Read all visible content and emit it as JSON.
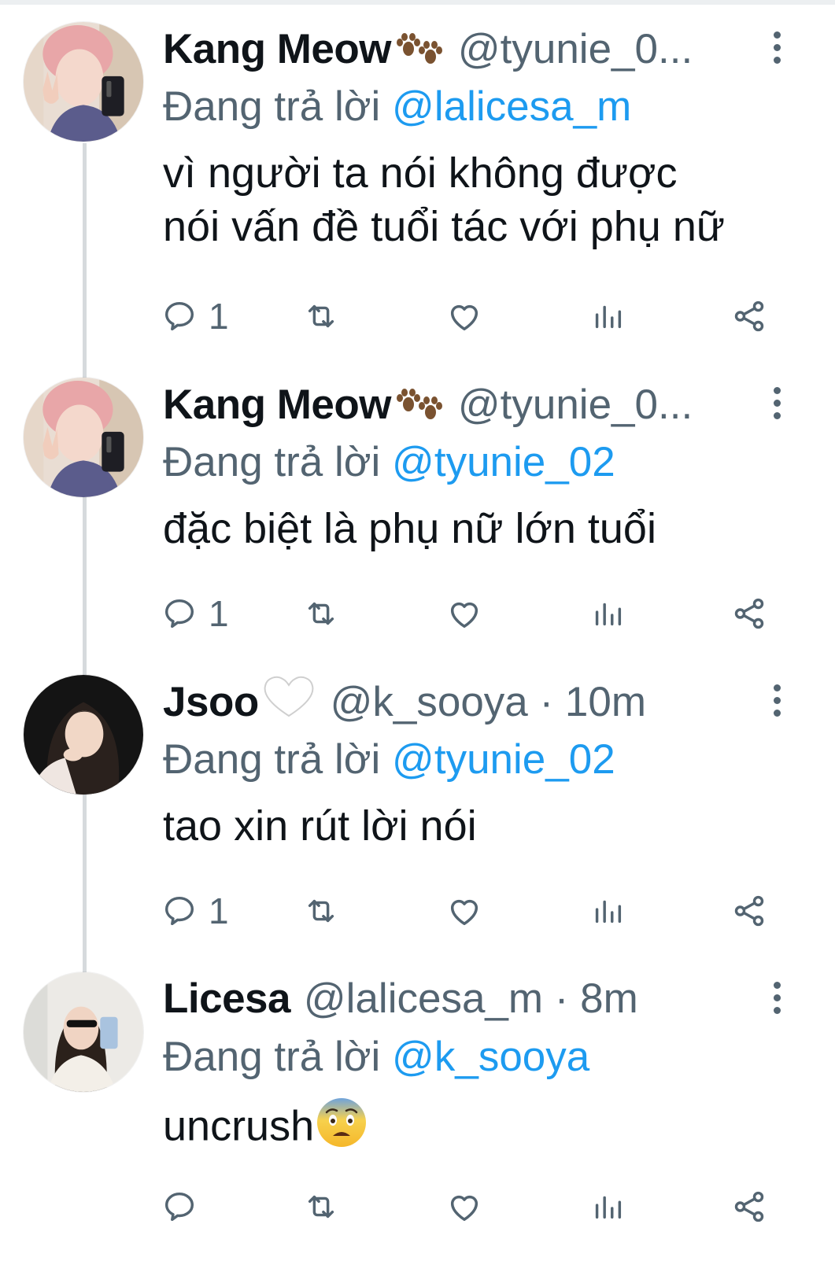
{
  "reply_prefix": "Đang trả lời",
  "tweets": [
    {
      "name": "Kang Meow",
      "name_emoji": "paw-prints",
      "handle": "@tyunie_0...",
      "replying_to": "@lalicesa_m",
      "text_lines": [
        "vì người ta nói không được",
        "nói vấn đề tuổi tác với phụ nữ"
      ],
      "reply_count": "1",
      "avatar": "avatar-boy"
    },
    {
      "name": "Kang Meow",
      "name_emoji": "paw-prints",
      "handle": "@tyunie_0...",
      "replying_to": "@tyunie_02",
      "text_lines": [
        "đặc biệt là phụ nữ lớn tuổi"
      ],
      "reply_count": "1",
      "avatar": "avatar-boy"
    },
    {
      "name": "Jsoo",
      "name_emoji": "white-heart",
      "handle": "@k_sooya · 10m",
      "replying_to": "@tyunie_02",
      "text_lines": [
        "tao xin rút lời nói"
      ],
      "reply_count": "1",
      "avatar": "avatar-girl-dark"
    },
    {
      "name": "Licesa",
      "name_emoji": "",
      "handle": "@lalicesa_m · 8m",
      "replying_to": "@k_sooya",
      "text_lines": [
        "uncrush"
      ],
      "text_emoji": "fearful-face",
      "reply_count": "",
      "avatar": "avatar-girl-light"
    }
  ],
  "colors": {
    "text_primary": "#0f1419",
    "text_secondary": "#536471",
    "mention": "#1d9bf0",
    "thread_line": "#d6dadd"
  }
}
